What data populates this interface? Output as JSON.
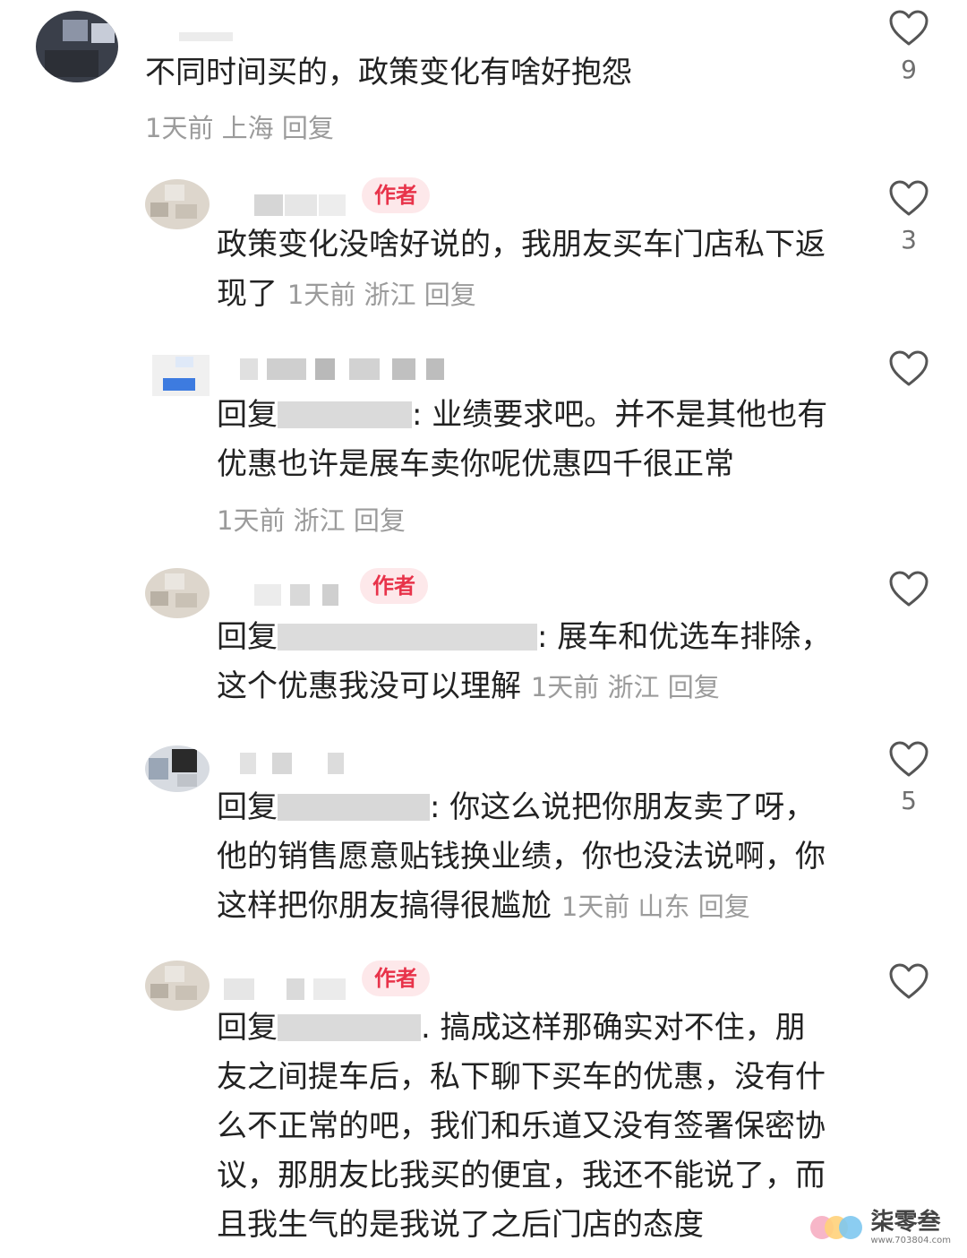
{
  "comments": [
    {
      "text": "不同时间买的，政策变化有啥好抱怨",
      "time": "1天前",
      "location": "上海",
      "reply_label": "回复",
      "likes": "9"
    },
    {
      "author_badge": "作者",
      "text": "政策变化没啥好说的，我朋友买车门店私下返现了",
      "time": "1天前",
      "location": "浙江",
      "reply_label": "回复",
      "likes": "3"
    },
    {
      "reply_prefix": "回复",
      "text": ": 业绩要求吧。并不是其他也有优惠也许是展车卖你呢优惠四千很正常",
      "time": "1天前",
      "location": "浙江",
      "reply_label": "回复",
      "likes": ""
    },
    {
      "author_badge": "作者",
      "reply_prefix": "回复",
      "text": ": 展车和优选车排除，这个优惠我没可以理解",
      "time": "1天前",
      "location": "浙江",
      "reply_label": "回复",
      "likes": ""
    },
    {
      "reply_prefix": "回复",
      "text": ": 你这么说把你朋友卖了呀，他的销售愿意贴钱换业绩，你也没法说啊，你这样把你朋友搞得很尴尬",
      "time": "1天前",
      "location": "山东",
      "reply_label": "回复",
      "likes": "5"
    },
    {
      "author_badge": "作者",
      "reply_prefix": "回复",
      "text": ". 搞成这样那确实对不住，朋友之间提车后，私下聊下买车的优惠，没有什么不正常的吧，我们和乐道又没有签署保密协议，那朋友比我买的便宜，我还不能说了，而且我生气的是我说了之后门店的态度",
      "likes": ""
    }
  ],
  "icons": {
    "like": "heart-outline-icon"
  },
  "colors": {
    "author_badge_bg": "#fde8ea",
    "author_badge_text": "#e8334a",
    "meta": "#9b9b9b"
  },
  "watermark": {
    "brand": "柒零叁",
    "url": "www.703804.com"
  }
}
